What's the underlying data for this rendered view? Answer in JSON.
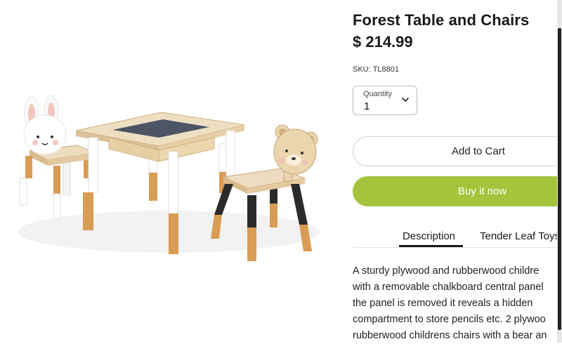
{
  "product": {
    "title": "Forest Table and Chairs",
    "price": "$ 214.99",
    "sku_label": "SKU:",
    "sku_value": "TL8801"
  },
  "quantity": {
    "label": "Quantity",
    "value": "1"
  },
  "buttons": {
    "add_to_cart": "Add to Cart",
    "buy_now": "Buy it now"
  },
  "tabs": [
    "Description",
    "Tender Leaf Toys"
  ],
  "description_lines": [
    "A sturdy plywood and rubberwood childre",
    "with a removable chalkboard central panel",
    "the panel is removed it reveals a hidden",
    "compartment to store pencils etc. 2 plywoo",
    "rubberwood childrens chairs with a bear an"
  ],
  "colors": {
    "buy_button": "#a3c43b",
    "text": "#1a1a1a"
  },
  "icons": {
    "quantity_dropdown": "chevron-down-icon"
  }
}
